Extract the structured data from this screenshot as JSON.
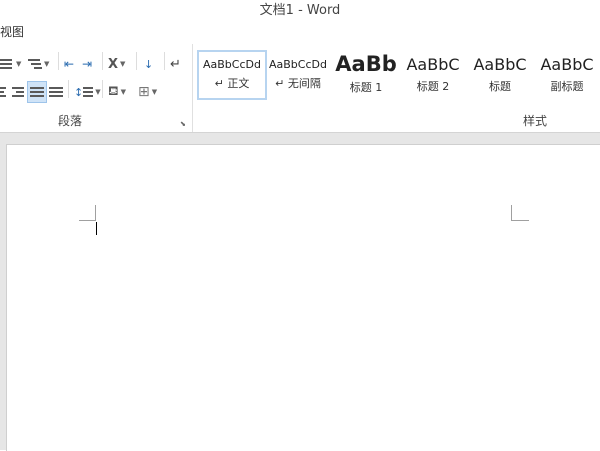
{
  "window": {
    "title": "文档1 - Word"
  },
  "menu": {
    "partial_tab": "视图"
  },
  "ribbon": {
    "paragraph": {
      "label": "段落",
      "buttons": [
        "bullets",
        "numbering",
        "multilevel-list",
        "decrease-indent",
        "increase-indent",
        "chinese-layout",
        "sort",
        "show-marks",
        "align-left",
        "align-center",
        "justify",
        "distributed",
        "line-spacing",
        "shading",
        "borders"
      ]
    },
    "styles": {
      "label": "样式",
      "items": [
        {
          "sample": "AaBbCcDd",
          "name": "正文",
          "selected": true,
          "mark": "↵"
        },
        {
          "sample": "AaBbCcDd",
          "name": "无间隔",
          "selected": false,
          "mark": "↵"
        },
        {
          "sample": "AaBb",
          "name": "标题 1",
          "selected": false,
          "mark": ""
        },
        {
          "sample": "AaBbC",
          "name": "标题 2",
          "selected": false,
          "mark": ""
        },
        {
          "sample": "AaBbC",
          "name": "标题",
          "selected": false,
          "mark": ""
        },
        {
          "sample": "AaBbC",
          "name": "副标题",
          "selected": false,
          "mark": ""
        }
      ]
    }
  },
  "colors": {
    "selected_style_border": "#b7d4f0",
    "active_button_bg": "#cfe3f7",
    "canvas_bg": "#e6e6e6"
  }
}
